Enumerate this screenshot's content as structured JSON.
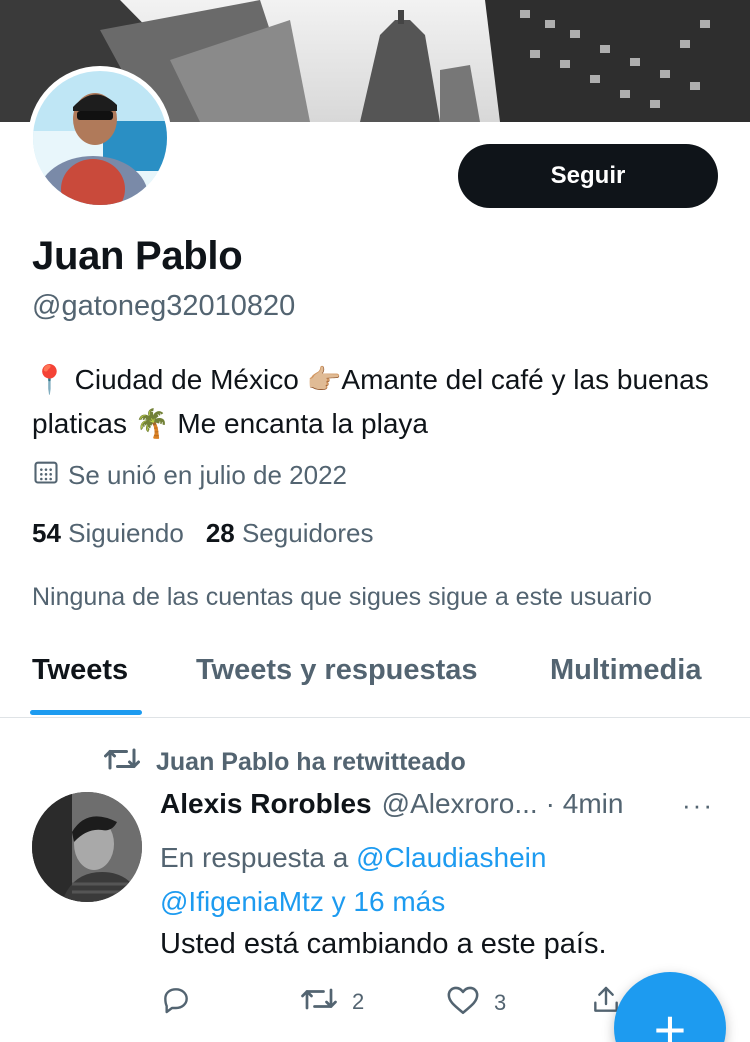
{
  "profile": {
    "name": "Juan Pablo",
    "handle": "@gatoneg32010820",
    "bio": "📍 Ciudad de México 👉🏼Amante del café y las buenas platicas 🌴 Me encanta la playa",
    "joined": "Se unió en julio de 2022",
    "following_count": "54",
    "following_label": "Siguiendo",
    "followers_count": "28",
    "followers_label": "Seguidores",
    "mutual_note": "Ninguna de las cuentas que sigues sigue a este usuario",
    "follow_button": "Seguir"
  },
  "tabs": [
    {
      "label": "Tweets",
      "active": true
    },
    {
      "label": "Tweets y respuestas",
      "active": false
    },
    {
      "label": "Multimedia",
      "active": false
    }
  ],
  "tweet": {
    "retweet_label": "Juan Pablo ha retwitteado",
    "author": "Alexis Rorobles",
    "handle": "@Alexroro...",
    "time": "· 4min",
    "more": "···",
    "reply_prefix": "En respuesta a ",
    "reply_user": "@Claudiashein",
    "reply_user2": "@IfigeniaMtz",
    "reply_more": "y 16 más",
    "text": "Usted está cambiando a este país.",
    "retweets": "2",
    "likes": "3"
  },
  "colors": {
    "accent": "#1d9bf0",
    "text": "#0f1419",
    "muted": "#536471",
    "button_bg": "#0f1419"
  },
  "icons": {
    "calendar": "calendar-icon",
    "retweet": "retweet-icon",
    "reply": "reply-icon",
    "like": "heart-icon",
    "share": "share-icon",
    "more": "more-icon",
    "compose": "compose-icon"
  }
}
